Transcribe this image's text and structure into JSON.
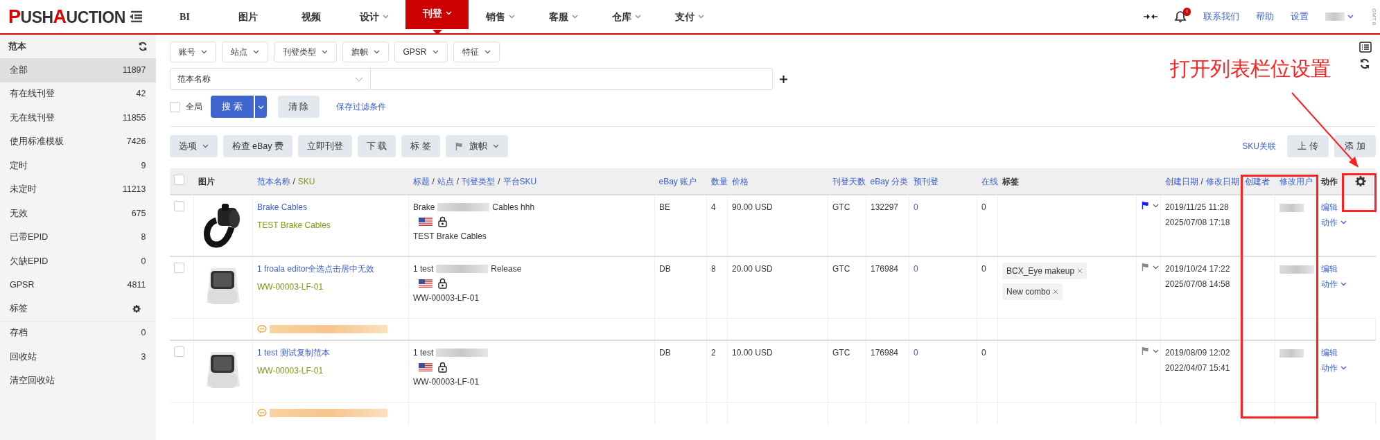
{
  "brand": {
    "parts": [
      {
        "text": "P",
        "accent": true
      },
      {
        "text": "USH",
        "accent": false
      },
      {
        "text": "A",
        "accent": true
      },
      {
        "text": "UCTION",
        "accent": false
      }
    ]
  },
  "nav": [
    {
      "label": "BI",
      "dropdown": false,
      "selected": false
    },
    {
      "label": "图片",
      "dropdown": false,
      "selected": false
    },
    {
      "label": "视频",
      "dropdown": false,
      "selected": false
    },
    {
      "label": "设计",
      "dropdown": true,
      "selected": false
    },
    {
      "label": "刊登",
      "dropdown": true,
      "selected": true
    },
    {
      "label": "销售",
      "dropdown": true,
      "selected": false
    },
    {
      "label": "客服",
      "dropdown": true,
      "selected": false
    },
    {
      "label": "仓库",
      "dropdown": true,
      "selected": false
    },
    {
      "label": "支付",
      "dropdown": true,
      "selected": false
    }
  ],
  "top_right": {
    "bell_badge": "!",
    "links": [
      "联系我们",
      "帮助",
      "设置"
    ],
    "timezone": "GMT 8"
  },
  "sidebar": {
    "title": "范本",
    "items": [
      {
        "label": "全部",
        "count": "11897",
        "selected": true,
        "kind": "count"
      },
      {
        "label": "有在线刊登",
        "count": "42",
        "selected": false,
        "kind": "count"
      },
      {
        "label": "无在线刊登",
        "count": "11855",
        "selected": false,
        "kind": "count"
      },
      {
        "label": "使用标准模板",
        "count": "7426",
        "selected": false,
        "kind": "count"
      },
      {
        "label": "定时",
        "count": "9",
        "selected": false,
        "kind": "count"
      },
      {
        "label": "未定时",
        "count": "11213",
        "selected": false,
        "kind": "count"
      },
      {
        "label": "无效",
        "count": "675",
        "selected": false,
        "kind": "count"
      },
      {
        "label": "已带EPID",
        "count": "8",
        "selected": false,
        "kind": "count"
      },
      {
        "label": "欠缺EPID",
        "count": "0",
        "selected": false,
        "kind": "count"
      },
      {
        "label": "GPSR",
        "count": "4811",
        "selected": false,
        "kind": "count"
      },
      {
        "label": "标签",
        "selected": false,
        "kind": "settings"
      },
      {
        "label": "存档",
        "count": "0",
        "selected": false,
        "kind": "count"
      },
      {
        "label": "回收站",
        "count": "3",
        "selected": false,
        "kind": "count"
      },
      {
        "label": "清空回收站",
        "selected": false,
        "kind": "plain"
      }
    ]
  },
  "filters": {
    "dropdowns": [
      "账号",
      "站点",
      "刊登类型",
      "旗帜",
      "GPSR",
      "特征"
    ],
    "field_select": "范本名称",
    "global": {
      "label": "全局",
      "checked": false
    },
    "search": "搜索",
    "clear": "清 除",
    "save": "保存过滤条件"
  },
  "actions": {
    "buttons": [
      {
        "label": "选项",
        "kind": "dropdown"
      },
      {
        "label": "检查 eBay 费",
        "kind": "plain"
      },
      {
        "label": "立即刊登",
        "kind": "plain"
      },
      {
        "label": "下 载",
        "kind": "plain"
      },
      {
        "label": "标 签",
        "kind": "plain"
      },
      {
        "label": "旗帜",
        "kind": "flag"
      }
    ],
    "link": "SKU关联",
    "right_buttons": [
      "上 传",
      "添 加"
    ]
  },
  "annotation": {
    "text": "打开列表栏位设置"
  },
  "table": {
    "header_checked": false,
    "columns": [
      {
        "kind": "check"
      },
      {
        "parts": [
          {
            "text": "图片",
            "kind": "plain"
          }
        ]
      },
      {
        "parts": [
          {
            "text": "范本名称",
            "kind": "link"
          },
          {
            "text": "/",
            "kind": "sep"
          },
          {
            "text": "SKU",
            "kind": "sku"
          }
        ]
      },
      {
        "parts": [
          {
            "text": "标题",
            "kind": "link"
          },
          {
            "text": "/",
            "kind": "sep"
          },
          {
            "text": "站点",
            "kind": "link"
          },
          {
            "text": "/",
            "kind": "sep"
          },
          {
            "text": "刊登类型",
            "kind": "link"
          },
          {
            "text": "/",
            "kind": "sep"
          },
          {
            "text": "平台SKU",
            "kind": "link"
          }
        ]
      },
      {
        "parts": [
          {
            "text": "eBay 账户",
            "kind": "link"
          }
        ]
      },
      {
        "parts": [
          {
            "text": "数量",
            "kind": "link"
          }
        ]
      },
      {
        "parts": [
          {
            "text": "价格",
            "kind": "link"
          }
        ]
      },
      {
        "parts": [
          {
            "text": "刊登天数",
            "kind": "link"
          }
        ]
      },
      {
        "parts": [
          {
            "text": "eBay 分类",
            "kind": "link"
          }
        ]
      },
      {
        "parts": [
          {
            "text": "预刊登",
            "kind": "link"
          }
        ]
      },
      {
        "parts": [
          {
            "text": "在线",
            "kind": "link"
          }
        ]
      },
      {
        "parts": [
          {
            "text": "标签",
            "kind": "plain"
          }
        ]
      },
      {
        "kind": "blank"
      },
      {
        "parts": [
          {
            "text": "创建日期",
            "kind": "link"
          },
          {
            "text": "/",
            "kind": "sep"
          },
          {
            "text": "修改日期",
            "kind": "link"
          }
        ]
      },
      {
        "parts": [
          {
            "text": "创建者",
            "kind": "link"
          }
        ]
      },
      {
        "parts": [
          {
            "text": "修改用户",
            "kind": "link"
          }
        ]
      },
      {
        "kind": "action",
        "parts": [
          {
            "text": "动作",
            "kind": "plain"
          }
        ]
      }
    ],
    "rows": [
      {
        "checked": false,
        "name": "Brake Cables",
        "sku": "TEST Brake Cables",
        "title": [
          {
            "text": "Brake"
          },
          {
            "kind": "redacted"
          },
          {
            "text": "Cables hhh"
          }
        ],
        "platform_sku": "TEST Brake Cables",
        "account": "BE",
        "qty": "4",
        "price": "90.00 USD",
        "days": "GTC",
        "category": "132297",
        "pre": "0",
        "online": "0",
        "tags": [],
        "color": "#1a1aff",
        "created": "2019/11/25 11:28",
        "modified": "2025/07/08 17:18",
        "edit": "编辑",
        "action": "动作",
        "comment": false
      },
      {
        "checked": false,
        "name": "1 froala editor全选点击居中无效",
        "sku": "WW-00003-LF-01",
        "title": [
          {
            "text": "1 test"
          },
          {
            "kind": "redacted"
          },
          {
            "text": "Release"
          }
        ],
        "platform_sku": "WW-00003-LF-01",
        "account": "DB",
        "qty": "8",
        "price": "20.00 USD",
        "days": "GTC",
        "category": "176984",
        "pre": "0",
        "online": "0",
        "tags": [
          "BCX_Eye makeup",
          "New combo"
        ],
        "color": "#888888",
        "created": "2019/10/24 17:22",
        "modified": "2025/07/08 14:58",
        "edit": "编辑",
        "action": "动作",
        "comment": true
      },
      {
        "checked": false,
        "name": "1 test 测试复制范本",
        "sku": "WW-00003-LF-01",
        "title": [
          {
            "text": "1 test"
          },
          {
            "kind": "redacted"
          }
        ],
        "platform_sku": "WW-00003-LF-01",
        "account": "DB",
        "qty": "2",
        "price": "10.00 USD",
        "days": "GTC",
        "category": "176984",
        "pre": "0",
        "online": "0",
        "tags": [],
        "color": "#888888",
        "created": "2019/08/09 12:02",
        "modified": "2022/04/07 15:41",
        "edit": "编辑",
        "action": "动作",
        "comment": true
      }
    ]
  }
}
